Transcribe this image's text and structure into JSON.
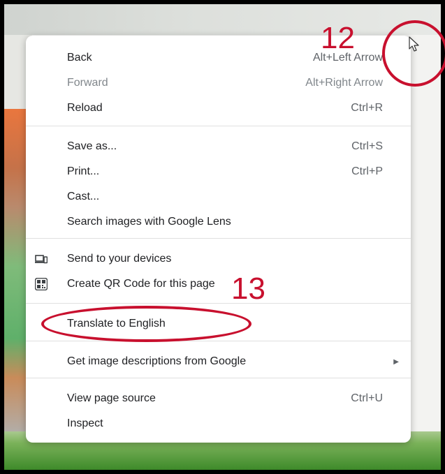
{
  "menu": {
    "items": [
      {
        "label": "Back",
        "shortcut": "Alt+Left Arrow"
      },
      {
        "label": "Forward",
        "shortcut": "Alt+Right Arrow",
        "disabled": true
      },
      {
        "label": "Reload",
        "shortcut": "Ctrl+R"
      },
      {
        "label": "Save as...",
        "shortcut": "Ctrl+S"
      },
      {
        "label": "Print...",
        "shortcut": "Ctrl+P"
      },
      {
        "label": "Cast..."
      },
      {
        "label": "Search images with Google Lens"
      },
      {
        "label": "Send to your devices",
        "icon": "devices-icon"
      },
      {
        "label": "Create QR Code for this page",
        "icon": "qr-code-icon"
      },
      {
        "label": "Translate to English"
      },
      {
        "label": "Get image descriptions from Google",
        "submenu_icon": "submenu-arrow-icon"
      },
      {
        "label": "View page source",
        "shortcut": "Ctrl+U"
      },
      {
        "label": "Inspect"
      }
    ]
  },
  "annotations": {
    "step_12": "12",
    "step_13": "13",
    "color": "#c8102e"
  },
  "cursor_icon": "mouse-pointer-icon"
}
